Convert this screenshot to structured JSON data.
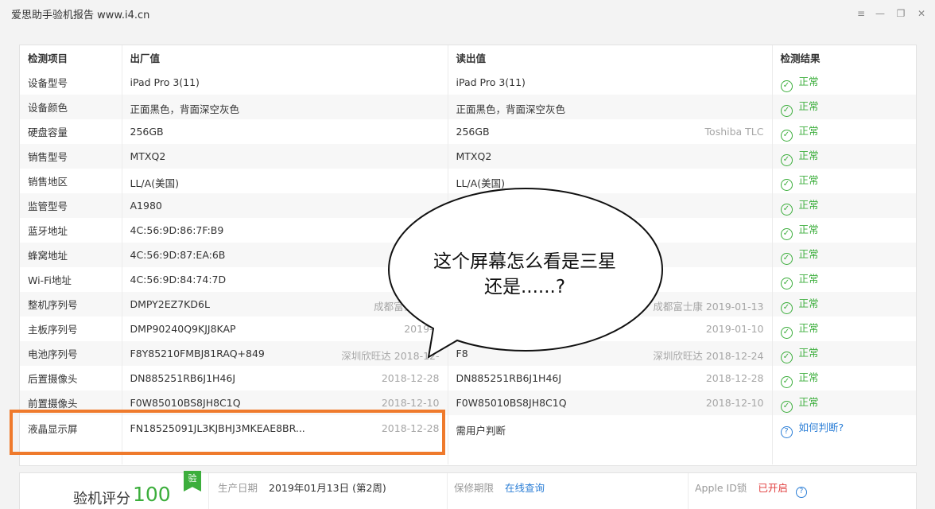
{
  "window": {
    "title": "爱思助手验机报告 www.i4.cn",
    "menu_icon": "≡",
    "minimize_icon": "—",
    "restore_icon": "❐",
    "close_icon": "✕"
  },
  "table": {
    "headers": [
      "检测项目",
      "出厂值",
      "读出值",
      "检测结果"
    ],
    "rows": [
      {
        "item": "设备型号",
        "factory": "iPad Pro 3(11)",
        "factory_sub": "",
        "read": "iPad Pro 3(11)",
        "read_sub": "",
        "result": "正常"
      },
      {
        "item": "设备颜色",
        "factory": "正面黑色，背面深空灰色",
        "factory_sub": "",
        "read": "正面黑色，背面深空灰色",
        "read_sub": "",
        "result": "正常"
      },
      {
        "item": "硬盘容量",
        "factory": "256GB",
        "factory_sub": "",
        "read": "256GB",
        "read_sub": "Toshiba TLC",
        "result": "正常"
      },
      {
        "item": "销售型号",
        "factory": "MTXQ2",
        "factory_sub": "",
        "read": "MTXQ2",
        "read_sub": "",
        "result": "正常"
      },
      {
        "item": "销售地区",
        "factory": "LL/A(美国)",
        "factory_sub": "",
        "read": "LL/A(美国)",
        "read_sub": "",
        "result": "正常"
      },
      {
        "item": "监管型号",
        "factory": "A1980",
        "factory_sub": "",
        "read": "",
        "read_sub": "",
        "result": "正常"
      },
      {
        "item": "蓝牙地址",
        "factory": "4C:56:9D:86:7F:B9",
        "factory_sub": "",
        "read": "",
        "read_sub": "",
        "result": "正常"
      },
      {
        "item": "蜂窝地址",
        "factory": "4C:56:9D:87:EA:6B",
        "factory_sub": "",
        "read": "",
        "read_sub": "",
        "result": "正常"
      },
      {
        "item": "Wi-Fi地址",
        "factory": "4C:56:9D:84:74:7D",
        "factory_sub": "",
        "read": "",
        "read_sub": "",
        "result": "正常"
      },
      {
        "item": "整机序列号",
        "factory": "DMPY2EZ7KD6L",
        "factory_sub": "成都富士康 20",
        "read": "",
        "read_sub": "成都富士康 2019-01-13",
        "result": "正常"
      },
      {
        "item": "主板序列号",
        "factory": "DMP90240Q9KJJ8KAP",
        "factory_sub": "2019-0",
        "read": "",
        "read_sub": "2019-01-10",
        "result": "正常"
      },
      {
        "item": "电池序列号",
        "factory": "F8Y85210FMBJ81RAQ+849",
        "factory_sub": "深圳欣旺达 2018-12-",
        "read": "F8",
        "read_sub": "深圳欣旺达 2018-12-24",
        "result": "正常"
      },
      {
        "item": "后置摄像头",
        "factory": "DN885251RB6J1H46J",
        "factory_sub": "2018-12-28",
        "read": "DN885251RB6J1H46J",
        "read_sub": "2018-12-28",
        "result": "正常"
      },
      {
        "item": "前置摄像头",
        "factory": "F0W85010BS8JH8C1Q",
        "factory_sub": "2018-12-10",
        "read": "F0W85010BS8JH8C1Q",
        "read_sub": "2018-12-10",
        "result": "正常"
      }
    ],
    "lcd_row": {
      "item": "液晶显示屏",
      "factory": "FN18525091JL3KJBHJ3MKEAE8BR...",
      "factory_sub": "2018-12-28",
      "read": "需用户判断",
      "result": "如何判断?"
    }
  },
  "bubble": {
    "text": "这个屏幕怎么看是三星还是......?"
  },
  "summary": {
    "score_label": "验机评分",
    "score": "100",
    "badge": "验",
    "production_date_label": "生产日期",
    "production_date": "2019年01月13日 (第2周)",
    "warranty_label": "保修期限",
    "warranty_link": "在线查询",
    "appleid_label": "Apple ID锁",
    "appleid_status": "已开启"
  },
  "colors": {
    "ok_green": "#3cae3c",
    "link_blue": "#2b7ed6",
    "highlight_orange": "#ef7a2c",
    "warn_red": "#e03a3a"
  }
}
